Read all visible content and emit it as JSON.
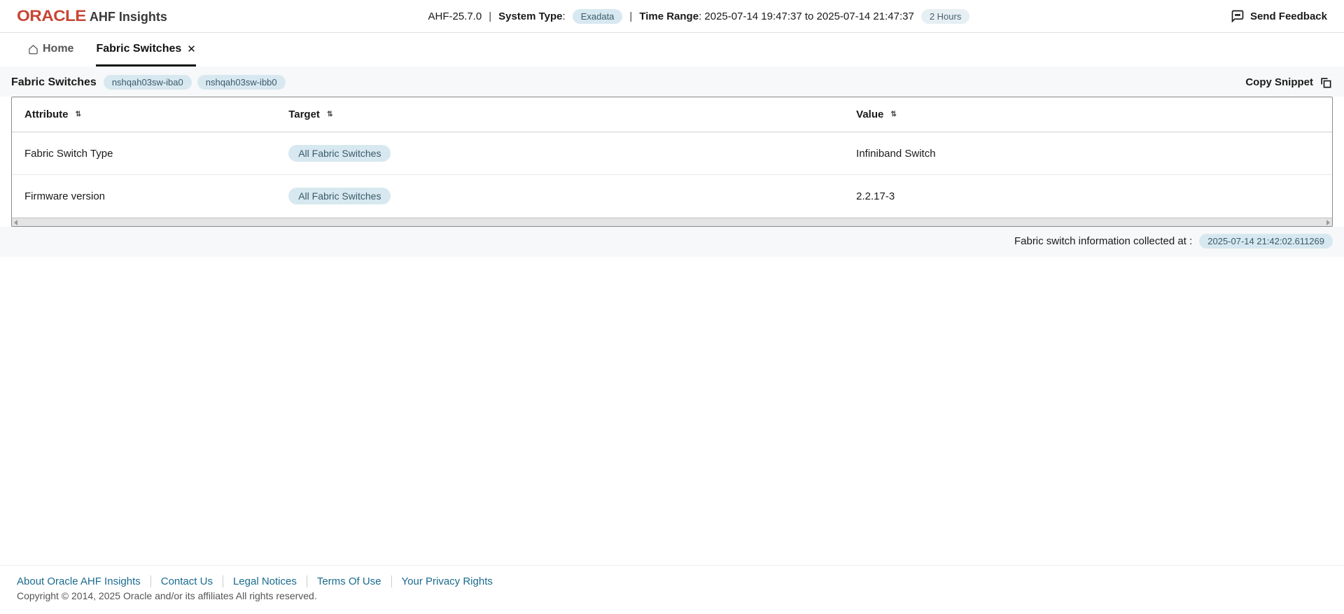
{
  "header": {
    "brand_word": "ORACLE",
    "product": "AHF Insights",
    "version": "AHF-25.7.0",
    "system_type_label": "System Type",
    "system_type_value": "Exadata",
    "time_range_label": "Time Range",
    "time_range_value": "2025-07-14 19:47:37 to 2025-07-14 21:47:37",
    "duration": "2 Hours",
    "feedback": "Send Feedback"
  },
  "tabs": {
    "home": "Home",
    "fabric": "Fabric Switches"
  },
  "section": {
    "title": "Fabric Switches",
    "switches": [
      "nshqah03sw-iba0",
      "nshqah03sw-ibb0"
    ],
    "copy": "Copy Snippet"
  },
  "table": {
    "columns": {
      "attribute": "Attribute",
      "target": "Target",
      "value": "Value"
    },
    "rows": [
      {
        "attribute": "Fabric Switch Type",
        "target": "All Fabric Switches",
        "value": "Infiniband Switch"
      },
      {
        "attribute": "Firmware version",
        "target": "All Fabric Switches",
        "value": "2.2.17-3"
      }
    ]
  },
  "info": {
    "label": "Fabric switch information collected at :",
    "timestamp": "2025-07-14 21:42:02.611269"
  },
  "footer": {
    "links": [
      "About Oracle AHF Insights",
      "Contact Us",
      "Legal Notices",
      "Terms Of Use",
      "Your Privacy Rights"
    ],
    "copyright": "Copyright © 2014, 2025 Oracle and/or its affiliates All rights reserved."
  }
}
